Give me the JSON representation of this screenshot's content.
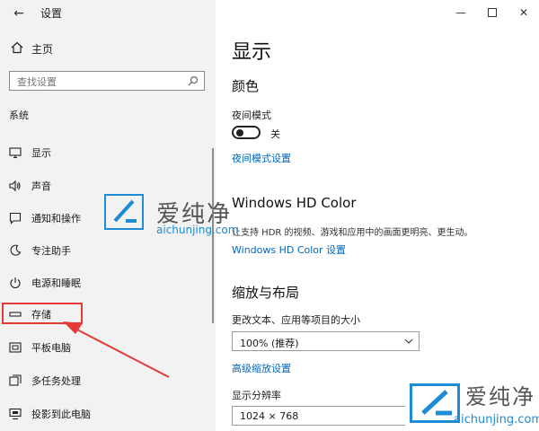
{
  "window": {
    "title": "设置",
    "back_icon": "back-arrow-icon",
    "controls": [
      "minimize-icon",
      "maximize-icon",
      "close-icon"
    ]
  },
  "sidebar": {
    "home": {
      "label": "主页",
      "icon": "home-icon"
    },
    "search": {
      "placeholder": "查找设置",
      "icon": "search-icon"
    },
    "section": "系统",
    "items": [
      {
        "label": "显示",
        "icon": "display-icon"
      },
      {
        "label": "声音",
        "icon": "sound-icon"
      },
      {
        "label": "通知和操作",
        "icon": "notifications-icon"
      },
      {
        "label": "专注助手",
        "icon": "focus-assist-icon"
      },
      {
        "label": "电源和睡眠",
        "icon": "power-icon"
      },
      {
        "label": "存储",
        "icon": "storage-icon",
        "highlighted": true
      },
      {
        "label": "平板电脑",
        "icon": "tablet-icon"
      },
      {
        "label": "多任务处理",
        "icon": "multitasking-icon"
      },
      {
        "label": "投影到此电脑",
        "icon": "projecting-icon"
      }
    ]
  },
  "main": {
    "title": "显示",
    "color_heading": "颜色",
    "night_light_label": "夜间模式",
    "night_light_state": "关",
    "night_light_link": "夜间模式设置",
    "hd_color_heading": "Windows HD Color",
    "hd_color_desc": "让支持 HDR 的视频、游戏和应用中的画面更明亮、更生动。",
    "hd_color_link": "Windows HD Color 设置",
    "scale_heading": "缩放与布局",
    "scale_label": "更改文本、应用等项目的大小",
    "scale_value": "100% (推荐)",
    "advanced_scale_link": "高级缩放设置",
    "resolution_label": "显示分辨率",
    "resolution_value": "1024 × 768"
  },
  "watermark": {
    "brand": "爱纯净",
    "url": "aichunjing.com"
  },
  "colors": {
    "accent_link": "#0067c0",
    "highlight": "#e53935",
    "watermark_blue": "#1e8bd6",
    "sidebar_bg": "#f2f2f2"
  }
}
